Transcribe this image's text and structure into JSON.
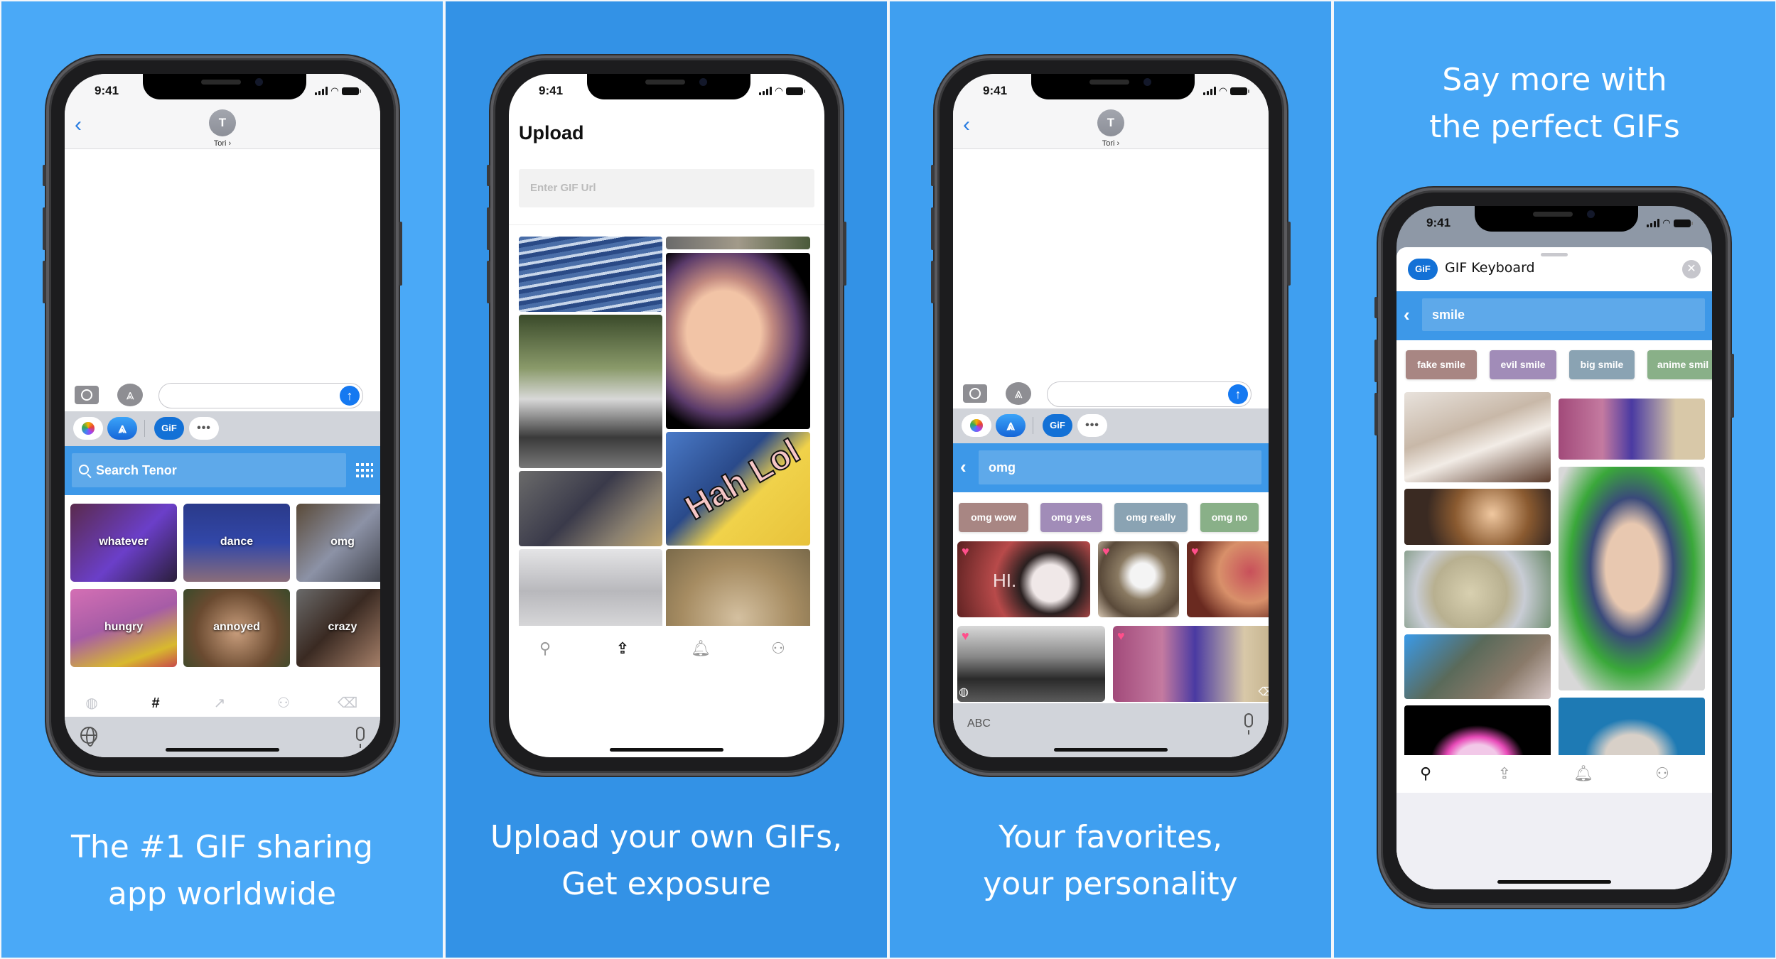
{
  "colors": {
    "panel_1_bg": "#4aa9f7",
    "panel_2_bg": "#3392e6",
    "panel_3_bg": "#3f9ff0",
    "panel_4_bg": "#46a6f5",
    "tenor_blue": "#3d98e8",
    "ios_blue": "#1579f1",
    "chip_colors": [
      "#a88683",
      "#a18cb8",
      "#8aa3b3",
      "#89b088"
    ]
  },
  "status_bar": {
    "time": "9:41"
  },
  "panels": [
    {
      "caption": [
        "The #1 GIF sharing",
        "app worldwide"
      ],
      "messages_header": {
        "avatar_initial": "T",
        "contact_name": "Tori ›"
      },
      "app_row": {
        "gif_label": "GiF",
        "more_label": "•••"
      },
      "search": {
        "placeholder": "Search Tenor"
      },
      "categories": [
        {
          "label": "whatever"
        },
        {
          "label": "dance"
        },
        {
          "label": "omg"
        },
        {
          "label": "hungry"
        },
        {
          "label": "annoyed"
        },
        {
          "label": "crazy"
        }
      ],
      "keyboard_tabs": [
        {
          "icon": "globe-icon",
          "glyph": "◍"
        },
        {
          "icon": "hashtag-icon",
          "glyph": "#"
        },
        {
          "icon": "trending-icon",
          "glyph": "↗"
        },
        {
          "icon": "profile-icon",
          "glyph": "⚇"
        },
        {
          "icon": "delete-icon",
          "glyph": "⌫"
        }
      ],
      "active_keyboard_tab": "#"
    },
    {
      "caption": [
        "Upload your own GIFs,",
        "Get exposure"
      ],
      "title": "Upload",
      "url_input": {
        "placeholder": "Enter GIF Url",
        "value": ""
      },
      "gif_grid": [
        {
          "name": "gif-water-reflection"
        },
        {
          "name": "gif-mountain-strip"
        },
        {
          "name": "gif-motorcycle-rider"
        },
        {
          "name": "gif-cartoon-face"
        },
        {
          "name": "gif-three-men"
        },
        {
          "name": "gif-hah-lol"
        },
        {
          "name": "gif-two-cats"
        },
        {
          "name": "gif-dog-phone"
        }
      ],
      "gif_text_overlay": "Hah Lol",
      "tabbar": [
        {
          "icon": "search-icon",
          "glyph": "⚲"
        },
        {
          "icon": "upload-icon",
          "glyph": "⇪"
        },
        {
          "icon": "bell-icon",
          "glyph": "🔔︎"
        },
        {
          "icon": "profile-icon",
          "glyph": "⚇"
        }
      ],
      "active_tab": "upload"
    },
    {
      "caption": [
        "Your favorites,",
        "your personality"
      ],
      "messages_header": {
        "avatar_initial": "T",
        "contact_name": "Tori ›"
      },
      "app_row": {
        "gif_label": "GiF",
        "more_label": "•••"
      },
      "search": {
        "value": "omg"
      },
      "suggestions": [
        "omg wow",
        "omg yes",
        "omg really",
        "omg no"
      ],
      "gif_overlay_text": "HI.",
      "keyboard": {
        "abc_label": "ABC"
      }
    },
    {
      "caption": [
        "Say more with",
        "the perfect GIFs"
      ],
      "sheet": {
        "logo_label": "GiF",
        "title": "GIF Keyboard",
        "close_glyph": "✕"
      },
      "search": {
        "value": "smile"
      },
      "suggestions": [
        "fake smile",
        "evil smile",
        "big smile",
        "anime smil"
      ],
      "tabbar": [
        {
          "icon": "search-icon",
          "glyph": "⚲"
        },
        {
          "icon": "upload-icon",
          "glyph": "⇪"
        },
        {
          "icon": "bell-icon",
          "glyph": "🔔︎"
        },
        {
          "icon": "profile-icon",
          "glyph": "⚇"
        }
      ],
      "active_tab": "search"
    }
  ]
}
